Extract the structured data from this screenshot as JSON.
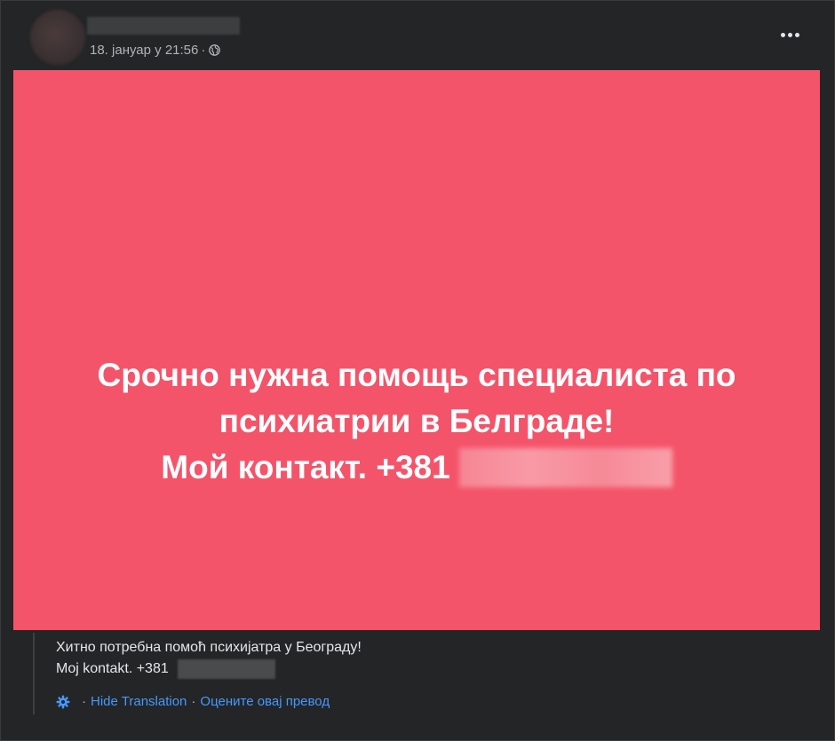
{
  "post": {
    "timestamp": "18. јануар у 21:56",
    "separator": "·",
    "privacy_icon": "globe-icon",
    "more_icon": "more-options-icon"
  },
  "image": {
    "background_color": "#f4546a",
    "line1": "Срочно нужна помощь специалиста по",
    "line2": "психиатрии в Белграде!",
    "line3": "Мой контакт. +381"
  },
  "translation": {
    "line1": "Хитно потребна помоћ психијатра у Београду!",
    "line2": "Moj kontakt. +381",
    "settings_icon": "gear-icon",
    "hide_label": "Hide Translation",
    "separator": "·",
    "rate_label": "Оцените овај превод",
    "link_color": "#4599ff"
  }
}
